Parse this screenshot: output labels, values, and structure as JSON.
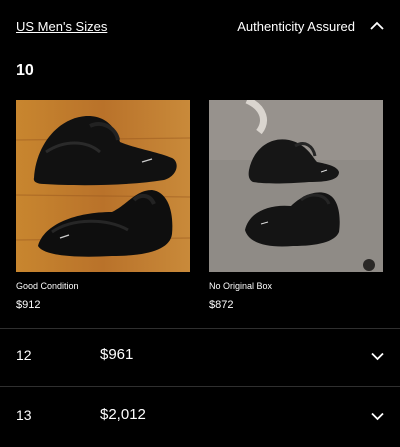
{
  "header": {
    "sizes_link": "US Men's Sizes",
    "authenticity": "Authenticity Assured",
    "collapse_icon": "chevron-up-icon"
  },
  "selected_size": {
    "label": "10",
    "listings": [
      {
        "condition": "Good Condition",
        "price": "$912"
      },
      {
        "condition": "No Original Box",
        "price": "$872"
      }
    ]
  },
  "size_rows": [
    {
      "size": "12",
      "price": "$961",
      "icon": "chevron-down-icon"
    },
    {
      "size": "13",
      "price": "$2,012",
      "icon": "chevron-down-icon"
    }
  ],
  "colors": {
    "background": "#000000",
    "divider": "#2f2f2f",
    "text": "#ffffff"
  }
}
